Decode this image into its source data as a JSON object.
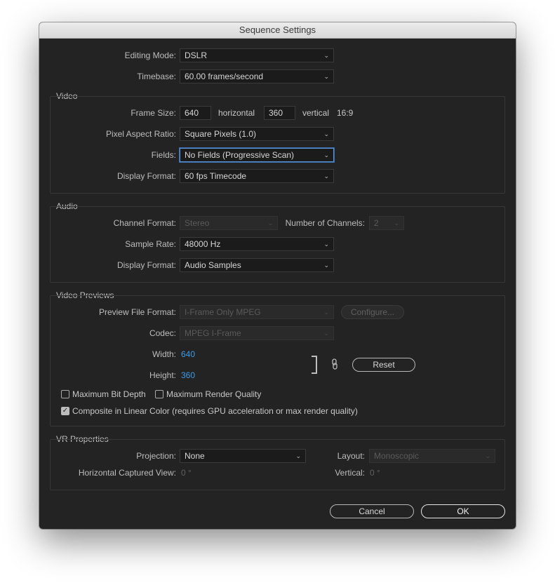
{
  "window": {
    "title": "Sequence Settings"
  },
  "top": {
    "editing_mode_label": "Editing Mode:",
    "editing_mode_value": "DSLR",
    "timebase_label": "Timebase:",
    "timebase_value": "60.00  frames/second"
  },
  "video": {
    "title": "Video",
    "frame_size_label": "Frame Size:",
    "frame_width": "640",
    "horizontal_label": "horizontal",
    "frame_height": "360",
    "vertical_label": "vertical",
    "aspect": "16:9",
    "pixel_aspect_label": "Pixel Aspect Ratio:",
    "pixel_aspect_value": "Square Pixels (1.0)",
    "fields_label": "Fields:",
    "fields_value": "No Fields (Progressive Scan)",
    "display_format_label": "Display Format:",
    "display_format_value": "60 fps Timecode"
  },
  "audio": {
    "title": "Audio",
    "channel_format_label": "Channel Format:",
    "channel_format_value": "Stereo",
    "num_channels_label": "Number of Channels:",
    "num_channels_value": "2",
    "sample_rate_label": "Sample Rate:",
    "sample_rate_value": "48000 Hz",
    "display_format_label": "Display Format:",
    "display_format_value": "Audio Samples"
  },
  "previews": {
    "title": "Video Previews",
    "preview_format_label": "Preview File Format:",
    "preview_format_value": "I-Frame Only MPEG",
    "configure_label": "Configure...",
    "codec_label": "Codec:",
    "codec_value": "MPEG I-Frame",
    "width_label": "Width:",
    "width_value": "640",
    "height_label": "Height:",
    "height_value": "360",
    "reset_label": "Reset",
    "max_bit_depth_label": "Maximum Bit Depth",
    "max_bit_depth_checked": false,
    "max_render_quality_label": "Maximum Render Quality",
    "max_render_quality_checked": false,
    "linear_color_label": "Composite in Linear Color (requires GPU acceleration or max render quality)",
    "linear_color_checked": true
  },
  "vr": {
    "title": "VR Properties",
    "projection_label": "Projection:",
    "projection_value": "None",
    "layout_label": "Layout:",
    "layout_value": "Monoscopic",
    "hcv_label": "Horizontal Captured View:",
    "hcv_value": "0 °",
    "vertical_label": "Vertical:",
    "vertical_value": "0 °"
  },
  "buttons": {
    "cancel": "Cancel",
    "ok": "OK"
  },
  "colors": {
    "accent_blue": "#3d9ae8",
    "dialog_bg": "#232323"
  }
}
